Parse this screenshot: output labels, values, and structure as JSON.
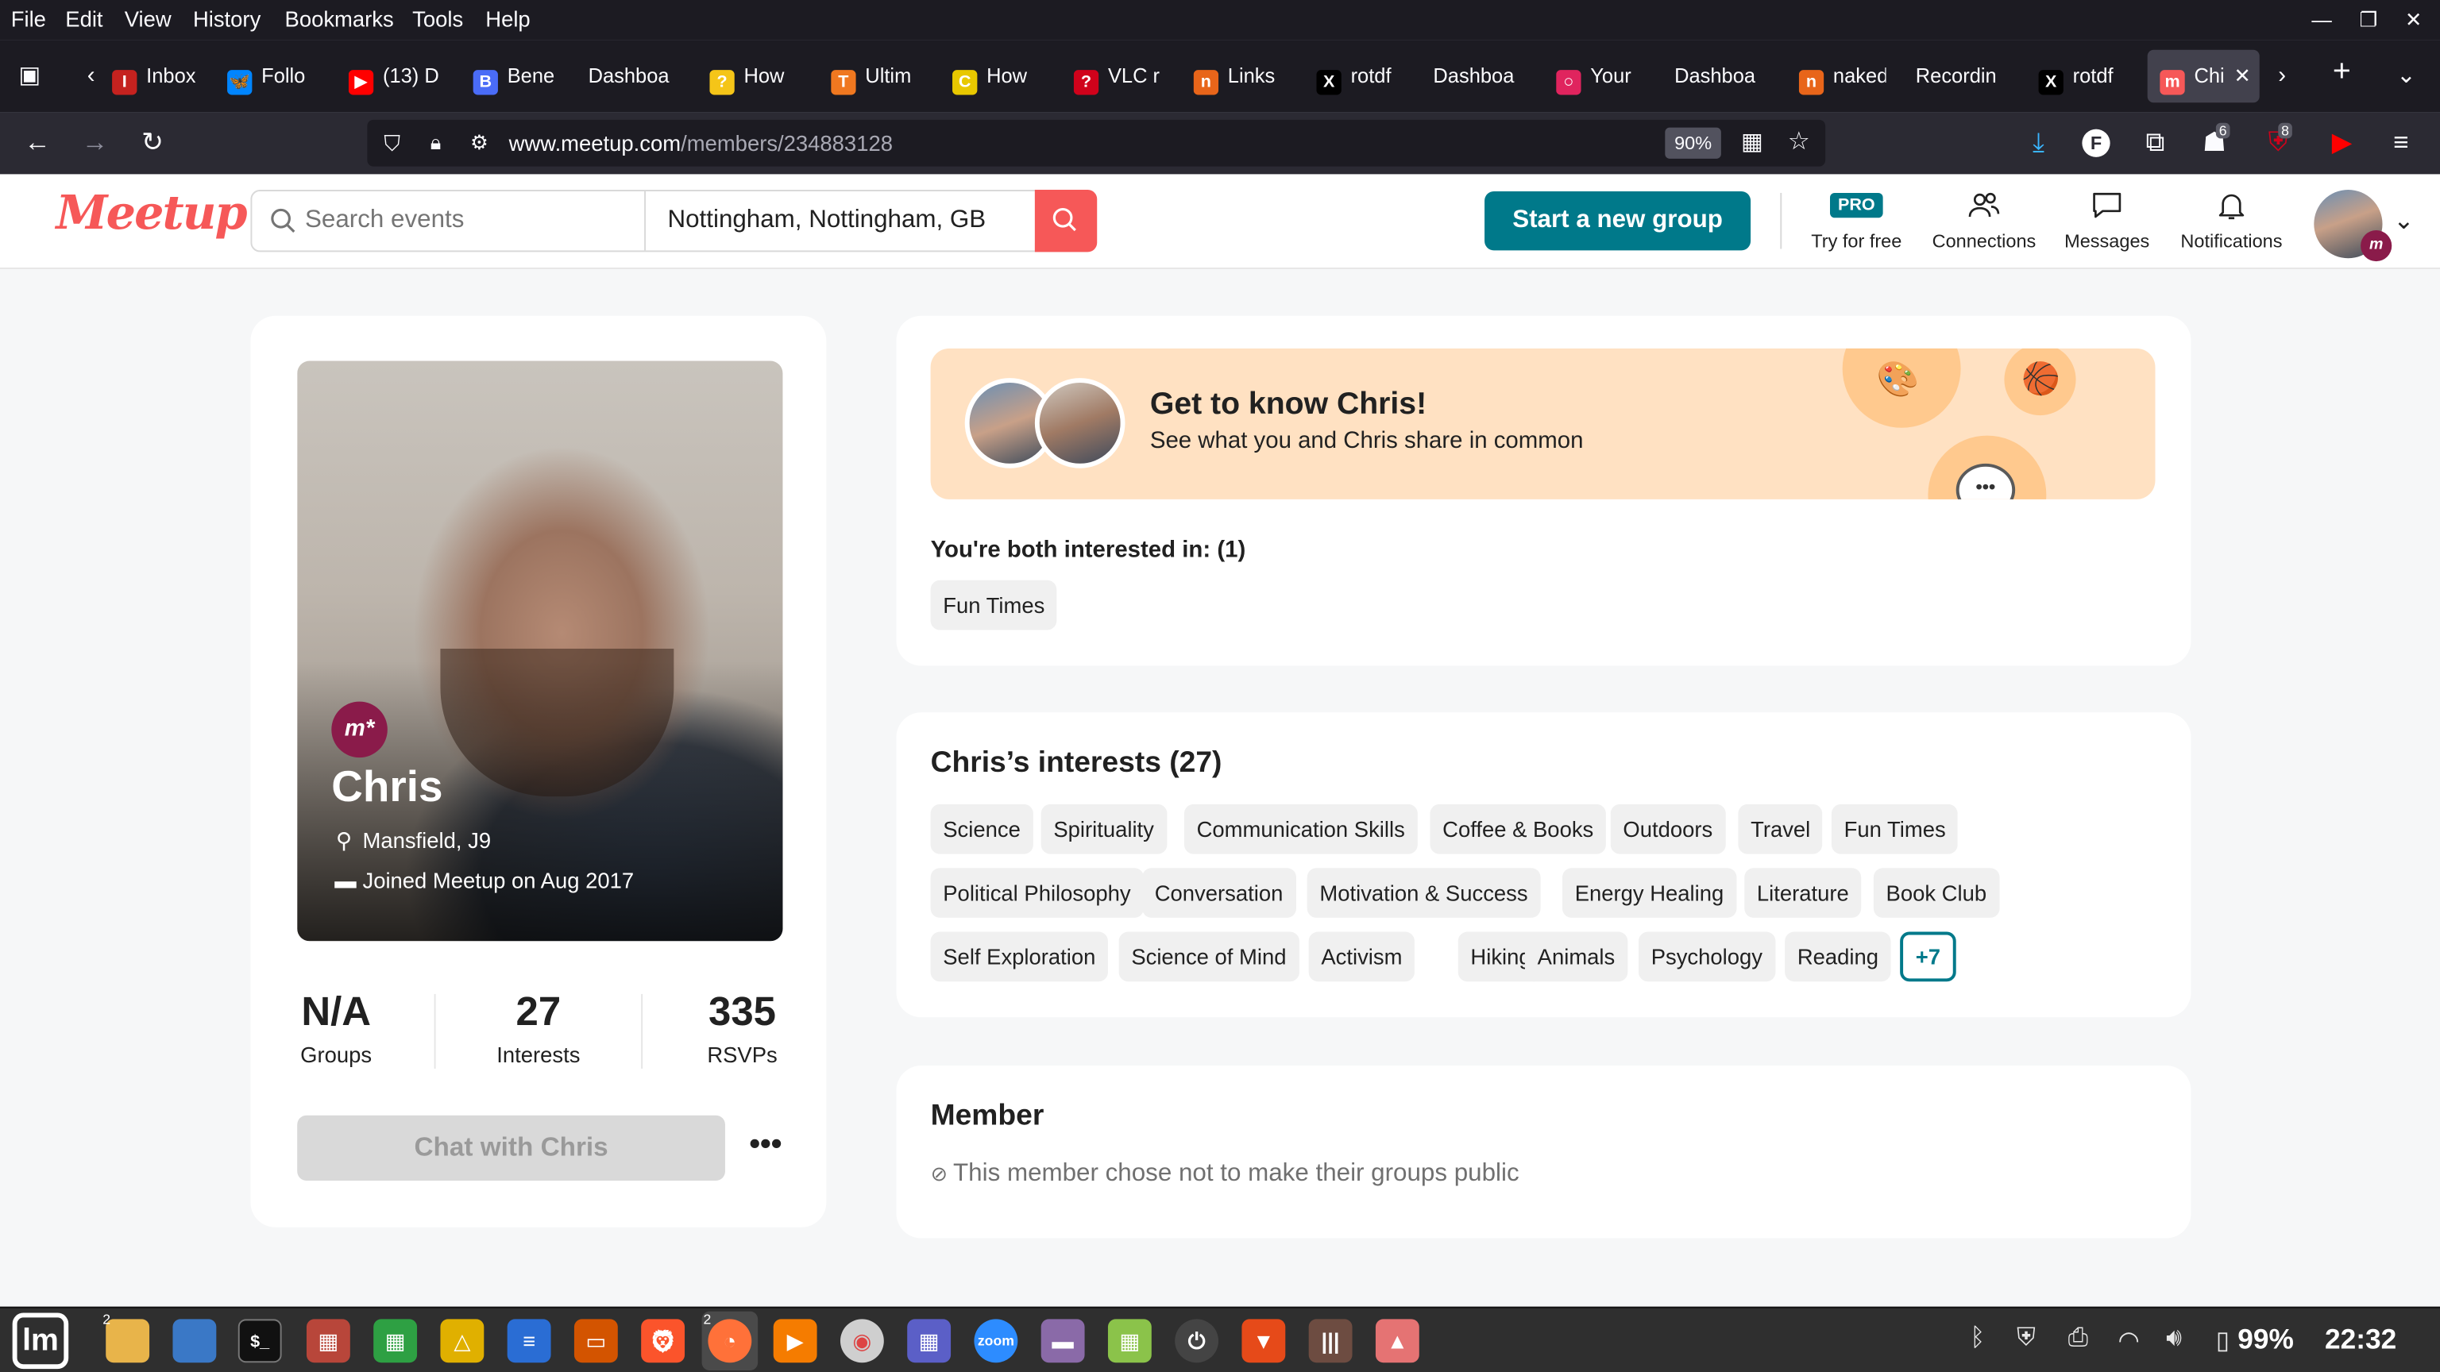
{
  "browser": {
    "menu": [
      "File",
      "Edit",
      "View",
      "History",
      "Bookmarks",
      "Tools",
      "Help"
    ],
    "tabs": [
      {
        "label": "Inbox",
        "color": "#c5221f",
        "glyph": "I"
      },
      {
        "label": "Follo",
        "color": "#0085ff",
        "glyph": "🦋"
      },
      {
        "label": "(13) D",
        "color": "#ff0000",
        "glyph": "▶"
      },
      {
        "label": "Bene",
        "color": "#4a6cf7",
        "glyph": "B"
      },
      {
        "label": "Dashboa",
        "color": "#1c1b22",
        "glyph": ""
      },
      {
        "label": "How",
        "color": "#f5c518",
        "glyph": "?"
      },
      {
        "label": "Ultim",
        "color": "#f07820",
        "glyph": "T"
      },
      {
        "label": "How",
        "color": "#e8c800",
        "glyph": "C"
      },
      {
        "label": "VLC r",
        "color": "#d0021b",
        "glyph": "?"
      },
      {
        "label": "Links",
        "color": "#e8651a",
        "glyph": "n"
      },
      {
        "label": "rotdf",
        "color": "#000000",
        "glyph": "X"
      },
      {
        "label": "Dashboa",
        "color": "#1c1b22",
        "glyph": ""
      },
      {
        "label": "Your",
        "color": "#e0245e",
        "glyph": "○"
      },
      {
        "label": "Dashboa",
        "color": "#1c1b22",
        "glyph": ""
      },
      {
        "label": "naked",
        "color": "#e8651a",
        "glyph": "n"
      },
      {
        "label": "Recordin",
        "color": "#1c1b22",
        "glyph": ""
      },
      {
        "label": "rotdf",
        "color": "#000000",
        "glyph": "X"
      },
      {
        "label": "Chi",
        "color": "#f65858",
        "glyph": "m"
      }
    ],
    "url_host": "www.meetup.com",
    "url_path": "/members/234883128",
    "zoom": "90%",
    "badges": {
      "ext1": "6",
      "ext2": "8"
    }
  },
  "header": {
    "logo": "Meetup",
    "search_placeholder": "Search events",
    "location": "Nottingham, Nottingham, GB",
    "start_group": "Start a new group",
    "pro_badge": "PRO",
    "try_free": "Try for free",
    "connections": "Connections",
    "messages": "Messages",
    "notifications": "Notifications"
  },
  "profile": {
    "badge": "m*",
    "name": "Chris",
    "location": "Mansfield, J9",
    "joined": "Joined Meetup on Aug 2017",
    "stats": [
      {
        "value": "N/A",
        "label": "Groups"
      },
      {
        "value": "27",
        "label": "Interests"
      },
      {
        "value": "335",
        "label": "RSVPs"
      }
    ],
    "chat_button": "Chat with Chris",
    "more": "•••"
  },
  "know": {
    "title": "Get to know Chris!",
    "subtitle": "See what you and Chris share in common",
    "both_heading": "You're both interested in: (1)",
    "both_chips": [
      "Fun Times"
    ]
  },
  "interests": {
    "title": "Chris’s interests (27)",
    "rows": [
      [
        "Science",
        "Spirituality",
        "Communication Skills",
        "Coffee & Books",
        "Outdoors",
        "Travel",
        "Fun Times"
      ],
      [
        "Political Philosophy",
        "Conversation",
        "Motivation & Success",
        "Energy Healing",
        "Literature",
        "Book Club"
      ],
      [
        "Self Exploration",
        "Science of Mind",
        "Activism",
        "Hiking",
        "Animals",
        "Psychology",
        "Reading"
      ]
    ],
    "more": "+7"
  },
  "member": {
    "title": "Member",
    "private_text": "This member chose not to make their groups public"
  },
  "taskbar": {
    "battery": "99%",
    "time": "22:32",
    "badge_files": "2",
    "badge_firefox": "2"
  },
  "colors": {
    "brand": "#f65858",
    "teal": "#00798a",
    "banner": "#ffe1c2"
  }
}
